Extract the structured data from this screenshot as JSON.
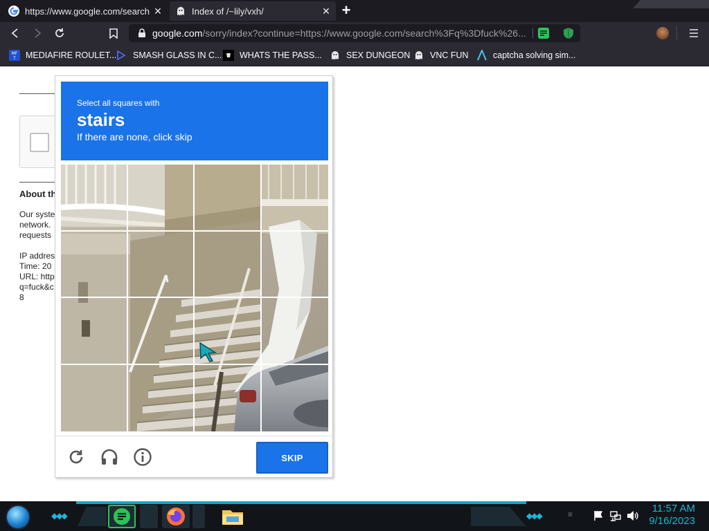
{
  "browser": {
    "tabs": [
      {
        "title": "https://www.google.com/search?q",
        "active": false
      },
      {
        "title": "Index of /~lily/vxh/",
        "active": true
      }
    ],
    "url_host": "google.com",
    "url_path": "/sorry/index?continue=https://www.google.com/search%3Fq%3Dfuck%26...",
    "bookmarks": [
      {
        "label": "MEDIAFIRE ROULET...",
        "icon": "mediafire-icon"
      },
      {
        "label": "SMASH GLASS IN C...",
        "icon": "code-icon"
      },
      {
        "label": "WHATS THE PASS...",
        "icon": "terminal-icon"
      },
      {
        "label": "SEX DUNGEON",
        "icon": "ghost-icon"
      },
      {
        "label": "VNC FUN",
        "icon": "ghost-icon"
      },
      {
        "label": "captcha solving sim...",
        "icon": "arrow-logo-icon"
      }
    ]
  },
  "background_page": {
    "heading": "About th",
    "lines": [
      "Our syste",
      "network.",
      "requests"
    ],
    "details": [
      "IP addres",
      "Time: 20",
      "URL: http",
      "q=fuck&c",
      "8"
    ]
  },
  "captcha": {
    "instruction_small": "Select all squares with",
    "target": "stairs",
    "instruction_sub": "If there are none, click skip",
    "grid_size": 4,
    "skip_label": "SKIP",
    "accent_color": "#1a73e8"
  },
  "taskbar": {
    "time": "11:57 AM",
    "date": "9/16/2023"
  }
}
